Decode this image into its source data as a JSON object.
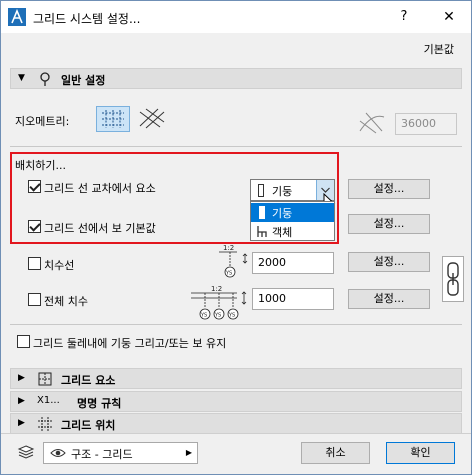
{
  "window": {
    "title": "그리드 시스템 설정...",
    "help_label": "?",
    "close_label": "✕"
  },
  "default_link": "기본값",
  "general": {
    "title": "일반 설정",
    "geometry_label": "지오메트리:",
    "geometry_value": "36000",
    "placement_label": "배치하기...",
    "intersection_checkbox": {
      "label": "그리드 선 교차에서 요소",
      "checked": true
    },
    "gridline_checkbox": {
      "label": "그리드 선에서 보 기본값",
      "checked": true
    },
    "element_select": {
      "selected": "기둥",
      "options": [
        "기둥",
        "객체"
      ],
      "highlighted_index": 0
    },
    "dimension_checkbox": {
      "label": "치수선",
      "checked": false,
      "value": "2000"
    },
    "overall_checkbox": {
      "label": "전체 치수",
      "checked": false,
      "value": "1000"
    },
    "diagram_labels": {
      "dim_top": "1:2",
      "badge_ys": "YS"
    },
    "settings_label": "설정...",
    "keep_checkbox": {
      "label": "그리드 둘레내에 기둥 그리고/또는 보 유지",
      "checked": false
    }
  },
  "sections": [
    {
      "title": "그리드 요소",
      "icon": "grid-element-icon"
    },
    {
      "title": "명명 규칙",
      "icon": "naming-icon",
      "prefix": "X1..."
    },
    {
      "title": "그리드 위치",
      "icon": "grid-position-icon"
    }
  ],
  "footer": {
    "layer": "구조 - 그리드",
    "cancel_label": "취소",
    "ok_label": "확인"
  },
  "colors": {
    "highlight": "#0078d7",
    "annotation_border": "#e2161e",
    "selection_bg": "#cce4f7"
  }
}
